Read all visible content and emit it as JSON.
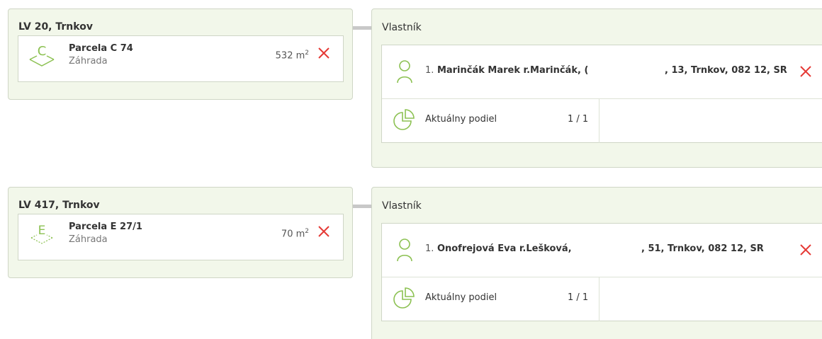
{
  "records": [
    {
      "lv_title": "LV 20, Trnkov",
      "parcel": {
        "icon_letter": "C",
        "name": "Parcela C 74",
        "type": "Záhrada",
        "area": "532 m",
        "area_unit_sup": "2"
      },
      "owner_heading": "Vlastník",
      "owner": {
        "index": "1.",
        "name": "Marinčák Marek r.Marinčák, (",
        "address": ", 13, Trnkov, 082 12, SR"
      },
      "share": {
        "label": "Aktuálny podiel",
        "value": "1 / 1"
      }
    },
    {
      "lv_title": "LV 417, Trnkov",
      "parcel": {
        "icon_letter": "E",
        "name": "Parcela E 27/1",
        "type": "Záhrada",
        "area": "70 m",
        "area_unit_sup": "2"
      },
      "owner_heading": "Vlastník",
      "owner": {
        "index": "1.",
        "name": "Onofrejová Eva r.Lešková,",
        "address": ", 51, Trnkov, 082 12, SR"
      },
      "share": {
        "label": "Aktuálny podiel",
        "value": "1 / 1"
      }
    }
  ],
  "colors": {
    "accent_green": "#8cc152",
    "remove_red": "#e53935",
    "card_bg": "#f2f7ea"
  },
  "icons": {
    "parcel": "parcel-diamond-icon",
    "person": "person-icon",
    "share": "pie-chart-icon",
    "remove": "close-icon"
  }
}
